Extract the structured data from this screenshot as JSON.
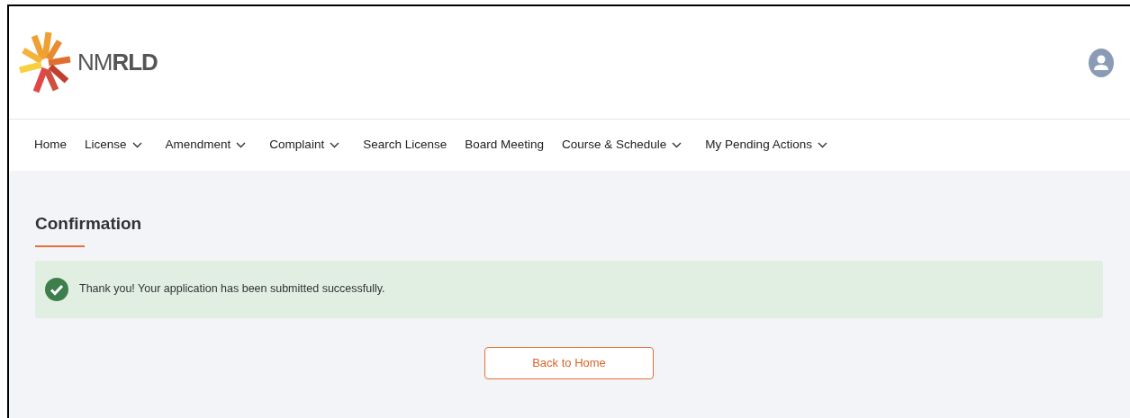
{
  "header": {
    "logo_text": "NM**RLD**"
  },
  "nav": [
    {
      "label": "Home",
      "dropdown": false
    },
    {
      "label": "License",
      "dropdown": true
    },
    {
      "label": "Amendment",
      "dropdown": true
    },
    {
      "label": "Complaint",
      "dropdown": true
    },
    {
      "label": "Search License",
      "dropdown": false
    },
    {
      "label": "Board Meeting",
      "dropdown": false
    },
    {
      "label": "Course & Schedule",
      "dropdown": true
    },
    {
      "label": "My Pending Actions",
      "dropdown": true
    }
  ],
  "content": {
    "title": "Confirmation",
    "alert": {
      "kind": "success",
      "message": "Thank you! Your application has been submitted successfully."
    },
    "button": "Back to Home"
  }
}
